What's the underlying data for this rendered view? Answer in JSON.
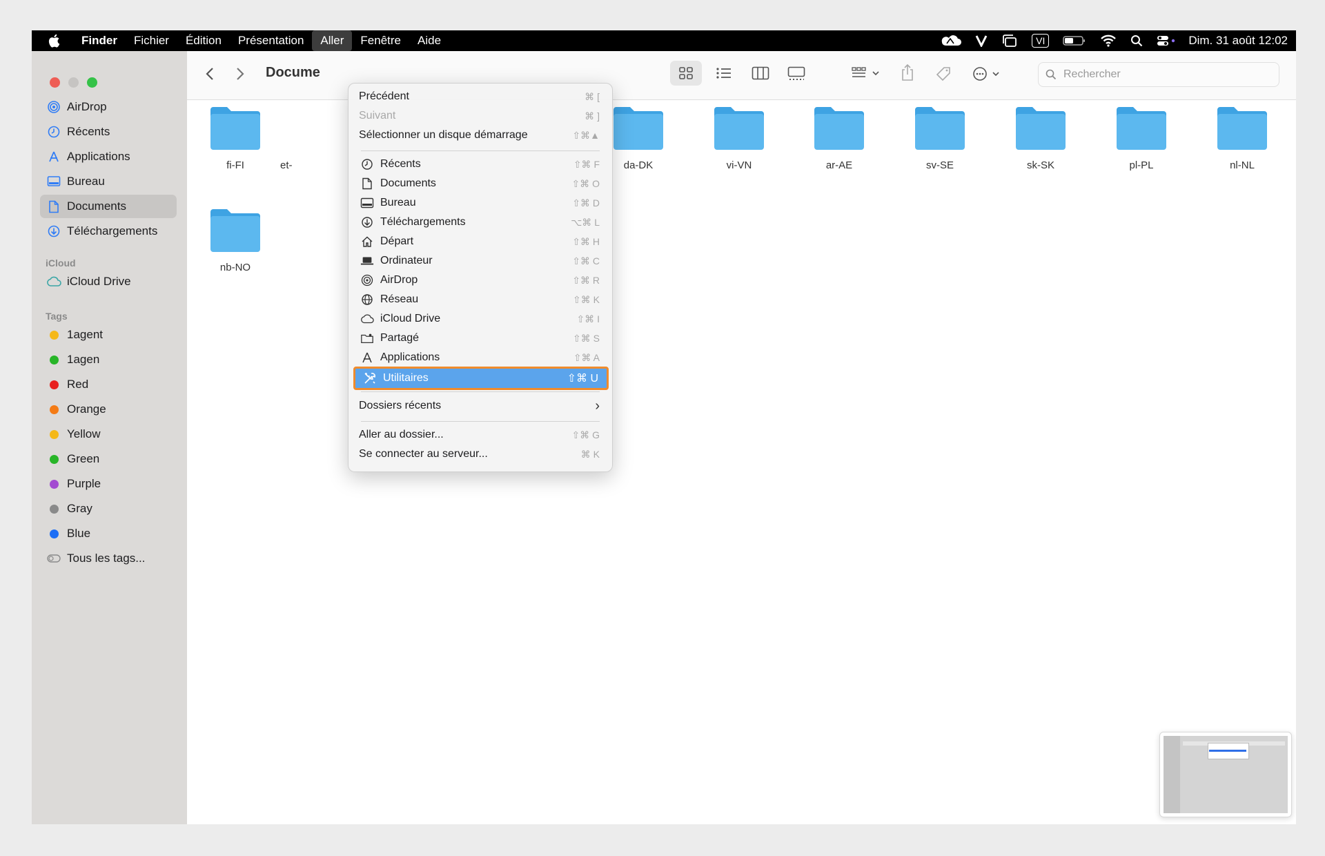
{
  "menubar": {
    "items": [
      "Finder",
      "Fichier",
      "Édition",
      "Présentation",
      "Aller",
      "Fenêtre",
      "Aide"
    ],
    "input_indicator": "VI",
    "clock": "Dim. 31 août  12:02"
  },
  "sidebar": {
    "favorites": [
      "AirDrop",
      "Récents",
      "Applications",
      "Bureau",
      "Documents",
      "Téléchargements"
    ],
    "selected": "Documents",
    "icloud_header": "iCloud",
    "icloud_items": [
      "iCloud Drive"
    ],
    "tags_header": "Tags",
    "tags": [
      {
        "label": "1agent",
        "color": "#f5b818"
      },
      {
        "label": "1agen",
        "color": "#28b528"
      },
      {
        "label": "Red",
        "color": "#e8201e"
      },
      {
        "label": "Orange",
        "color": "#f47b15"
      },
      {
        "label": "Yellow",
        "color": "#f5b818"
      },
      {
        "label": "Green",
        "color": "#28b528"
      },
      {
        "label": "Purple",
        "color": "#a34bd1"
      },
      {
        "label": "Gray",
        "color": "#8a8a8a"
      },
      {
        "label": "Blue",
        "color": "#1d6ef5"
      }
    ],
    "all_tags": "Tous les tags..."
  },
  "toolbar": {
    "title": "Docume",
    "search_placeholder": "Rechercher"
  },
  "folders": [
    "fi-FI",
    "et-",
    "da-DK",
    "vi-VN",
    "ar-AE",
    "sv-SE",
    "sk-SK",
    "pl-PL",
    "nl-NL",
    "nb-NO"
  ],
  "go_menu": {
    "items": [
      {
        "label": "Précédent",
        "shortcut": "⌘ [",
        "icon": "none",
        "disabled": false
      },
      {
        "label": "Suivant",
        "shortcut": "⌘ ]",
        "icon": "none",
        "disabled": true
      },
      {
        "label": "Sélectionner un disque démarrage",
        "shortcut": "⇧⌘▲",
        "icon": "none",
        "disabled": false
      },
      {
        "label": "Récents",
        "shortcut": "⇧⌘ F",
        "icon": "clock-icon"
      },
      {
        "label": "Documents",
        "shortcut": "⇧⌘ O",
        "icon": "document-icon"
      },
      {
        "label": "Bureau",
        "shortcut": "⇧⌘ D",
        "icon": "desktop-icon"
      },
      {
        "label": "Téléchargements",
        "shortcut": "⌥⌘ L",
        "icon": "download-icon"
      },
      {
        "label": "Départ",
        "shortcut": "⇧⌘ H",
        "icon": "home-icon"
      },
      {
        "label": "Ordinateur",
        "shortcut": "⇧⌘ C",
        "icon": "laptop-icon"
      },
      {
        "label": "AirDrop",
        "shortcut": "⇧⌘ R",
        "icon": "airdrop-icon"
      },
      {
        "label": "Réseau",
        "shortcut": "⇧⌘ K",
        "icon": "globe-icon"
      },
      {
        "label": "iCloud Drive",
        "shortcut": "⇧⌘ I",
        "icon": "cloud-icon"
      },
      {
        "label": "Partagé",
        "shortcut": "⇧⌘ S",
        "icon": "shared-folder-icon"
      },
      {
        "label": "Applications",
        "shortcut": "⇧⌘ A",
        "icon": "applications-icon"
      },
      {
        "label": "Utilitaires",
        "shortcut": "⇧⌘ U",
        "icon": "utilities-icon",
        "highlighted": true
      },
      {
        "label": "Dossiers récents",
        "shortcut": "›",
        "icon": "none"
      },
      {
        "label": "Aller au dossier...",
        "shortcut": "⇧⌘ G",
        "icon": "none"
      },
      {
        "label": "Se connecter au serveur...",
        "shortcut": "⌘ K",
        "icon": "none"
      }
    ]
  },
  "colors": {
    "folder": "#5cb8ef",
    "folder_dark": "#3ea3e3",
    "highlight": "#5ba4ec",
    "highlight_border": "#f08b2c",
    "accent": "#1d6ef5"
  }
}
